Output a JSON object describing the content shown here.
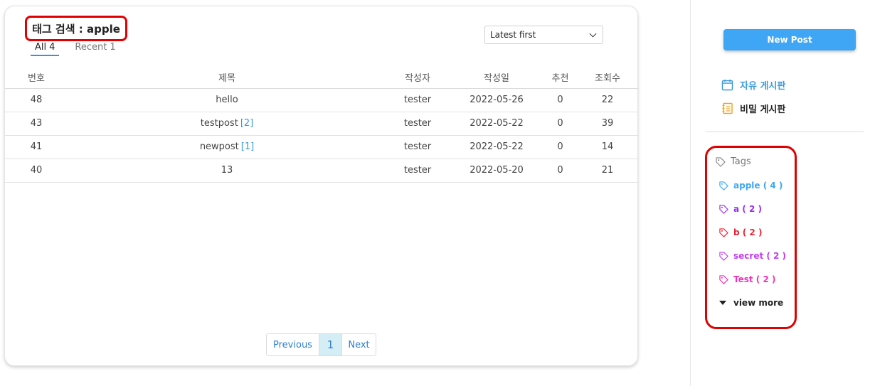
{
  "header": {
    "title": "태그 검색 : apple"
  },
  "tabs": [
    {
      "label": "All",
      "count": "4"
    },
    {
      "label": "Recent",
      "count": "1"
    }
  ],
  "sort": {
    "selected": "Latest first"
  },
  "table": {
    "columns": [
      "번호",
      "제목",
      "작성자",
      "작성일",
      "추천",
      "조회수"
    ],
    "rows": [
      {
        "no": "48",
        "title": "hello",
        "comments": "",
        "author": "tester",
        "date": "2022-05-26",
        "rec": "0",
        "views": "22"
      },
      {
        "no": "43",
        "title": "testpost",
        "comments": "[2]",
        "author": "tester",
        "date": "2022-05-22",
        "rec": "0",
        "views": "39"
      },
      {
        "no": "41",
        "title": "newpost",
        "comments": "[1]",
        "author": "tester",
        "date": "2022-05-22",
        "rec": "0",
        "views": "14"
      },
      {
        "no": "40",
        "title": "13",
        "comments": "",
        "author": "tester",
        "date": "2022-05-20",
        "rec": "0",
        "views": "21"
      }
    ]
  },
  "pagination": {
    "prev": "Previous",
    "current": "1",
    "next": "Next"
  },
  "sidebar": {
    "new_post": "New Post",
    "boards": [
      {
        "label": "자유 게시판",
        "icon": "calendar-icon",
        "color": "#3a9ad9"
      },
      {
        "label": "비밀 게시판",
        "icon": "notebook-icon",
        "color": "#f0a020"
      }
    ],
    "tags_heading": "Tags",
    "tags": [
      {
        "label": "apple ( 4 )",
        "color": "#3ea6f5"
      },
      {
        "label": "a ( 2 )",
        "color": "#9b30f0"
      },
      {
        "label": "b ( 2 )",
        "color": "#ee2233"
      },
      {
        "label": "secret ( 2 )",
        "color": "#c43cf0"
      },
      {
        "label": "Test ( 2 )",
        "color": "#ee33bb"
      }
    ],
    "view_more": "view more"
  },
  "colors": {
    "accent": "#3ea6f5",
    "highlight": "#e00000"
  }
}
